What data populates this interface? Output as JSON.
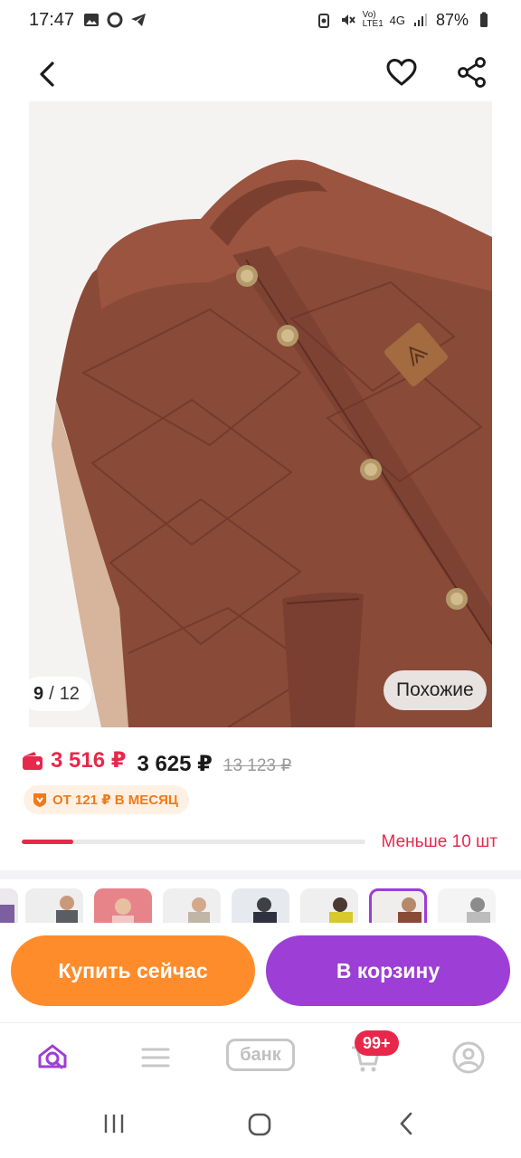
{
  "status_bar": {
    "time": "17:47",
    "network": "4G",
    "lte": "Vo) LTE1",
    "battery": "87%"
  },
  "gallery": {
    "current": "9",
    "separator": "/",
    "total": "12",
    "similar_label": "Похожие"
  },
  "price": {
    "wallet_price": "3 516 ₽",
    "price": "3 625 ₽",
    "old_price": "13 123 ₽",
    "installment": "ОТ 121 ₽ В МЕСЯЦ"
  },
  "stock": {
    "label": "Меньше 10 шт",
    "level": 0.15
  },
  "actions": {
    "buy_now": "Купить сейчас",
    "add_to_cart": "В корзину"
  },
  "tabbar": {
    "bank_label": "банк",
    "cart_badge": "99+"
  },
  "colors": {
    "accent_red": "#e8284b",
    "buy_orange": "#ff8c2a",
    "cart_purple": "#9d3ed6"
  }
}
